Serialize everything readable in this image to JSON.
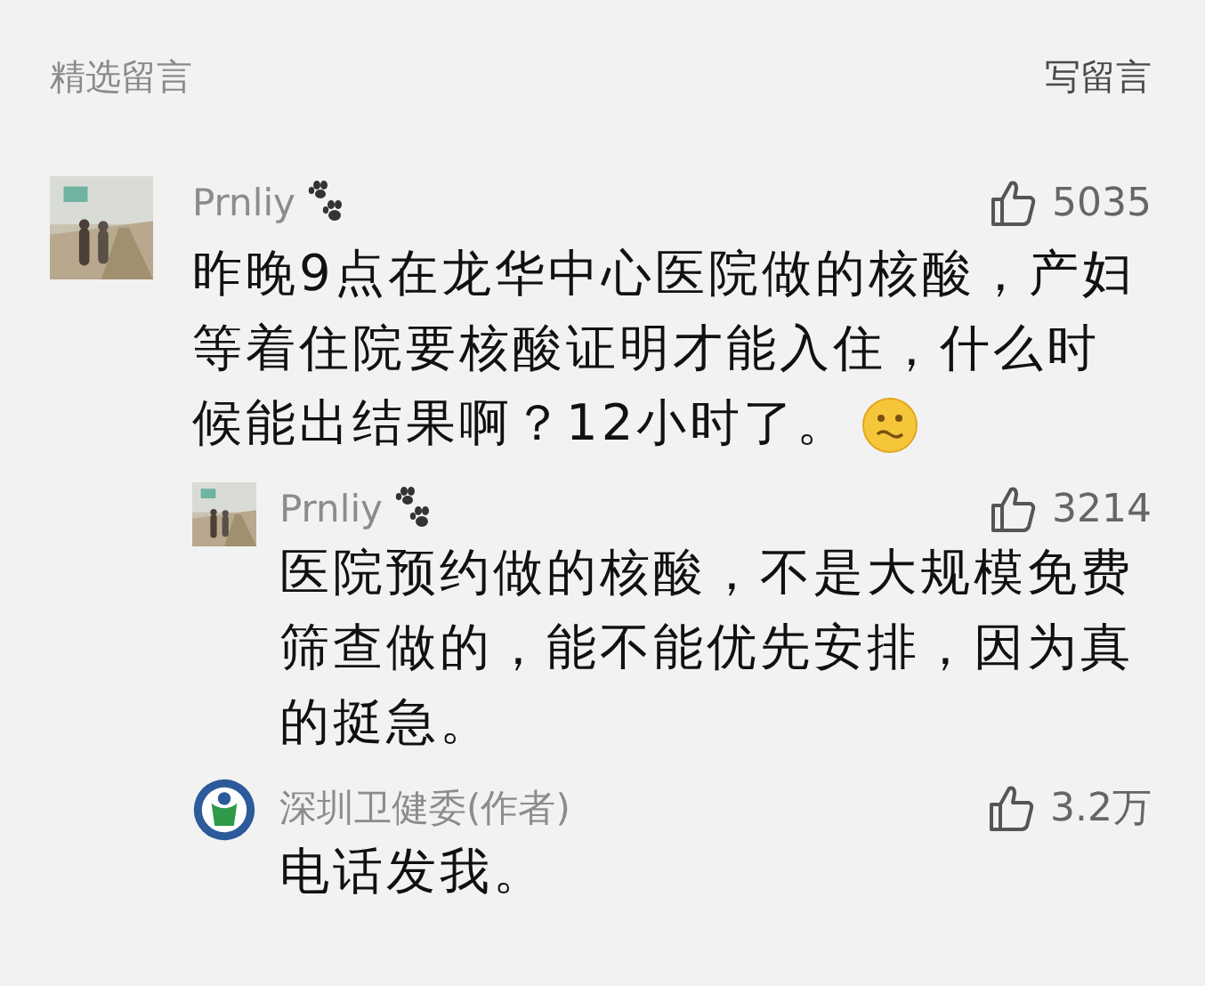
{
  "header": {
    "title": "精选留言",
    "write_label": "写留言"
  },
  "comments": [
    {
      "author": "Prnliy",
      "paw": true,
      "likes": "5035",
      "text": "昨晚9点在龙华中心医院做的核酸，产妇等着住院要核酸证明才能入住，什么时候能出结果啊？12小时了。",
      "emoji": true,
      "replies": [
        {
          "author": "Prnliy",
          "paw": true,
          "likes": "3214",
          "text": "医院预约做的核酸，不是大规模免费筛查做的，能不能优先安排，因为真的挺急。",
          "emoji": false
        },
        {
          "author": "深圳卫健委(作者)",
          "kind": "logo",
          "paw": false,
          "likes": "3.2万",
          "text": "电话发我。",
          "emoji": false
        }
      ]
    }
  ]
}
